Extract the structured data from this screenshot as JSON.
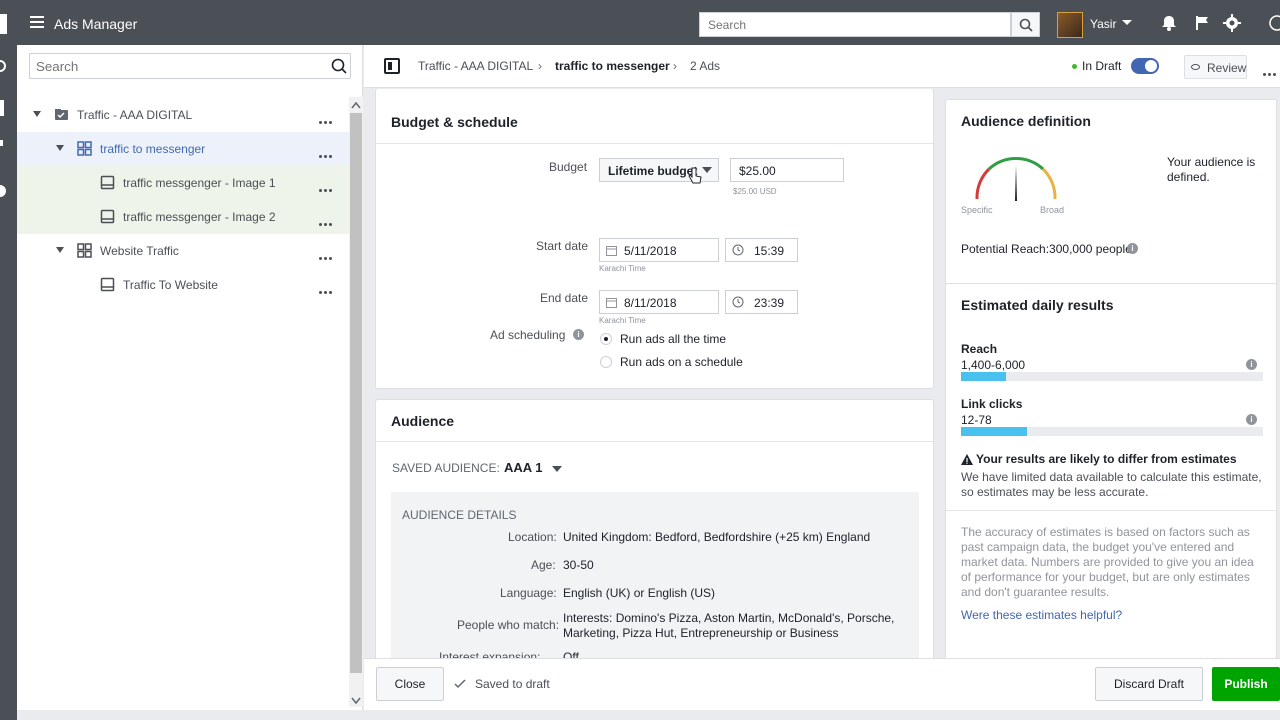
{
  "app": {
    "title": "Ads Manager"
  },
  "topbar": {
    "search_placeholder": "Search",
    "user_name": "Yasir"
  },
  "tree": {
    "search_placeholder": "Search",
    "items": [
      {
        "label": "Traffic - AAA DIGITAL",
        "level": "campaign"
      },
      {
        "label": "traffic to messenger",
        "level": "adset"
      },
      {
        "label": "traffic messgenger - Image 1",
        "level": "ad"
      },
      {
        "label": "traffic messgenger - Image 2",
        "level": "ad"
      },
      {
        "label": "Website Traffic",
        "level": "adset"
      },
      {
        "label": "Traffic To Website",
        "level": "ad"
      }
    ]
  },
  "breadcrumb": {
    "campaign": "Traffic - AAA DIGITAL",
    "adset": "traffic to messenger",
    "ads": "2 Ads"
  },
  "status": {
    "draft_label": "In Draft",
    "draft_toggle_on": true,
    "review_label": "Review"
  },
  "budget": {
    "heading": "Budget & schedule",
    "budget_label": "Budget",
    "budget_type": "Lifetime budget",
    "budget_value": "$25.00",
    "budget_usd": "$25.00 USD",
    "start_label": "Start date",
    "start_date": "5/11/2018",
    "start_time": "15:39",
    "start_tz": "Karachi Time",
    "end_label": "End date",
    "end_date": "8/11/2018",
    "end_time": "23:39",
    "end_tz": "Karachi Time",
    "scheduling_label": "Ad scheduling",
    "options": [
      "Run ads all the time",
      "Run ads on a schedule"
    ],
    "selected_option": "Run ads all the time"
  },
  "audience": {
    "heading": "Audience",
    "saved_label": "SAVED AUDIENCE:",
    "saved_value": "AAA 1",
    "details_heading": "AUDIENCE DETAILS",
    "location_label": "Location:",
    "location_value": "United Kingdom: Bedford, Bedfordshire (+25 km) England",
    "age_label": "Age:",
    "age_value": "30-50",
    "language_label": "Language:",
    "language_value": "English (UK) or English (US)",
    "match_label": "People who match:",
    "match_value_1": "Interests: Domino's Pizza, Aston Martin, McDonald's, Porsche,",
    "match_value_2": "Marketing, Pizza Hut, Entrepreneurship or Business",
    "expansion_label": "Interest expansion:",
    "expansion_value": "Off"
  },
  "audience_definition": {
    "heading": "Audience definition",
    "gauge_left": "Specific",
    "gauge_right": "Broad",
    "message": "Your audience is defined.",
    "reach_label": "Potential Reach:300,000 people"
  },
  "estimates": {
    "heading": "Estimated daily results",
    "reach_label": "Reach",
    "reach_value": "1,400-6,000",
    "reach_fill": 0.15,
    "clicks_label": "Link clicks",
    "clicks_value": "12-78",
    "clicks_fill": 0.22,
    "warning_title": "Your results are likely to differ from estimates",
    "warning_body": "We have limited data available to calculate this estimate, so estimates may be less accurate.",
    "accuracy_text": "The accuracy of estimates is based on factors such as past campaign data, the budget you've entered and market data. Numbers are provided to give you an idea of performance for your budget, but are only estimates and don't guarantee results.",
    "helpful_link": "Were these estimates helpful?"
  },
  "footer": {
    "close_label": "Close",
    "saved_label": "Saved to draft",
    "discard_label": "Discard Draft",
    "publish_label": "Publish"
  },
  "colors": {
    "accent": "#4267b2",
    "publish": "#00a400",
    "progress": "#48c1ee",
    "topbar": "#4b4f56"
  }
}
